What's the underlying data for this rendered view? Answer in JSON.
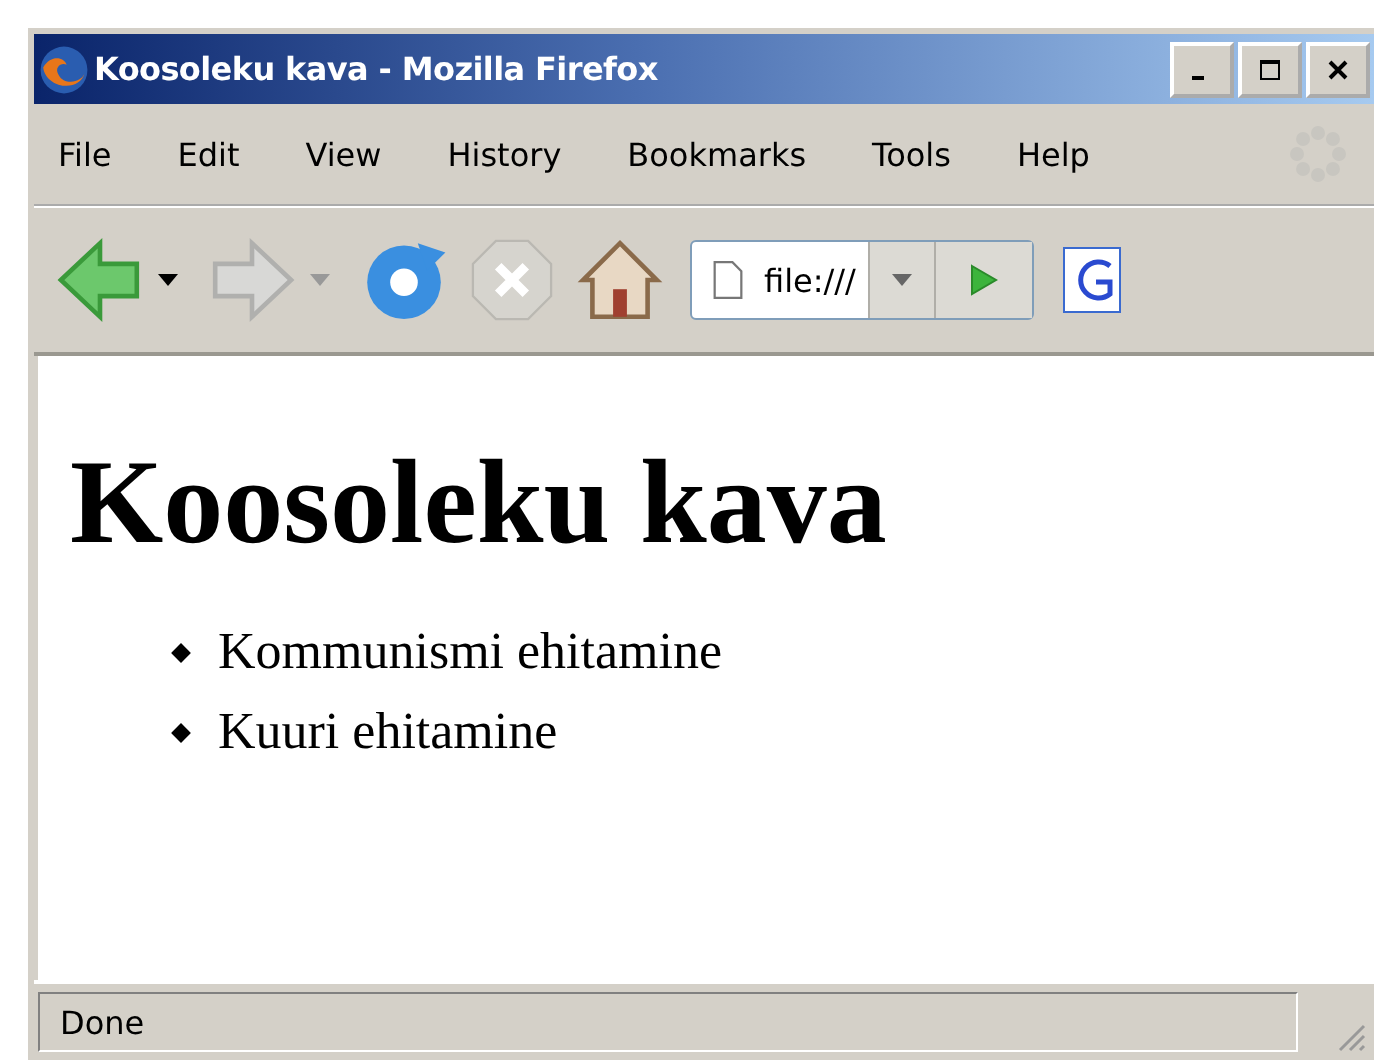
{
  "window": {
    "title": "Koosoleku kava - Mozilla Firefox"
  },
  "menu": [
    "File",
    "Edit",
    "View",
    "History",
    "Bookmarks",
    "Tools",
    "Help"
  ],
  "address_bar": {
    "value": "file:///"
  },
  "page": {
    "heading": "Koosoleku kava",
    "items": [
      "Kommunismi ehitamine",
      "Kuuri ehitamine"
    ]
  },
  "status_bar": {
    "text": "Done"
  }
}
